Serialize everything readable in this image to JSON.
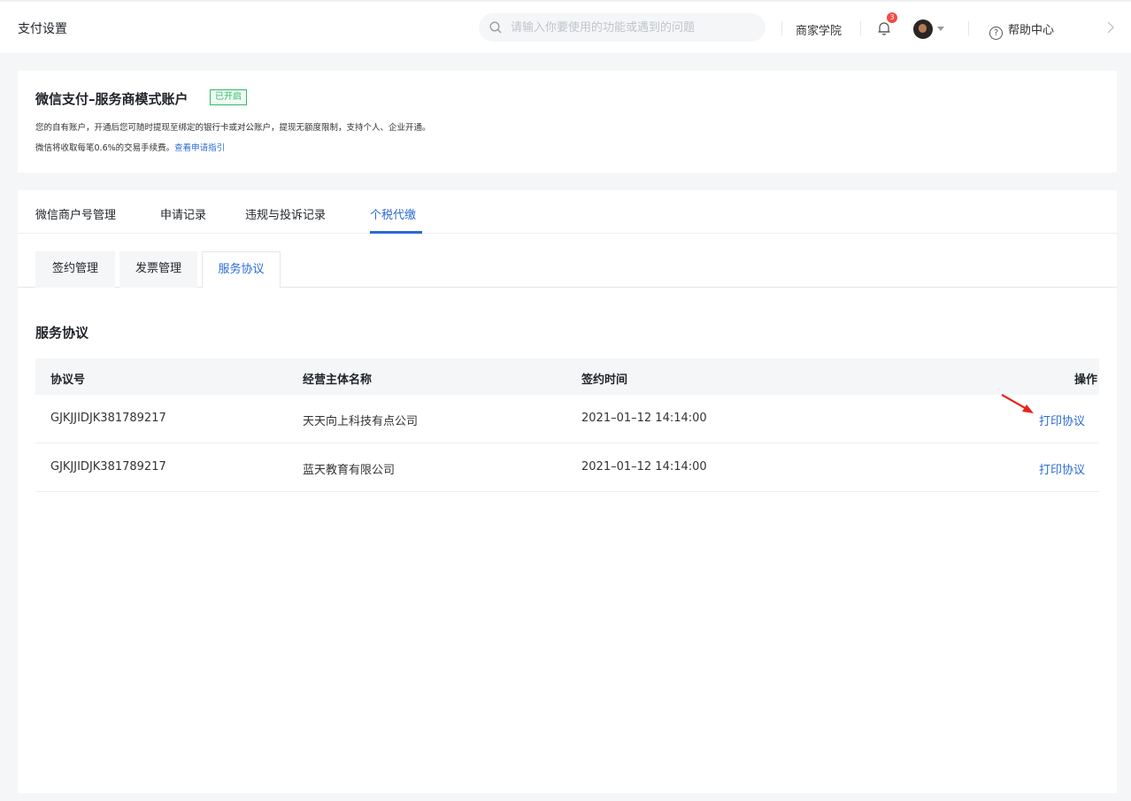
{
  "header": {
    "title": "支付设置",
    "search_placeholder": "请输入你要使用的功能或遇到的问题",
    "academy_label": "商家学院",
    "notification_count": "3",
    "help_label": "帮助中心"
  },
  "account": {
    "title": "微信支付–服务商模式账户",
    "status": "已开启",
    "desc1": "您的自有账户，开通后您可随时提现至绑定的银行卡或对公账户，提现无额度限制，支持个人、企业开通。",
    "desc2": "微信将收取每笔0.6%的交易手续费。",
    "guide_link": "查看申请指引"
  },
  "tabs": [
    {
      "label": "微信商户号管理",
      "active": false
    },
    {
      "label": "申请记录",
      "active": false
    },
    {
      "label": "违规与投诉记录",
      "active": false
    },
    {
      "label": "个税代缴",
      "active": true
    }
  ],
  "subtabs": [
    {
      "label": "签约管理",
      "active": false
    },
    {
      "label": "发票管理",
      "active": false
    },
    {
      "label": "服务协议",
      "active": true
    }
  ],
  "section": {
    "title": "服务协议"
  },
  "table": {
    "columns": [
      "协议号",
      "经营主体名称",
      "签约时间",
      "操作"
    ],
    "rows": [
      {
        "id": "GJKJJIDJK381789217",
        "name": "天天向上科技有点公司",
        "time": "2021–01–12 14:14:00",
        "action": "打印协议"
      },
      {
        "id": "GJKJJIDJK381789217",
        "name": "蓝天教育有限公司",
        "time": "2021–01–12 14:14:00",
        "action": "打印协议"
      }
    ]
  },
  "colors": {
    "accent": "#2c6ad6",
    "success": "#2fbb6a",
    "badge": "#f54a45",
    "annotation_arrow": "#e8231b"
  }
}
